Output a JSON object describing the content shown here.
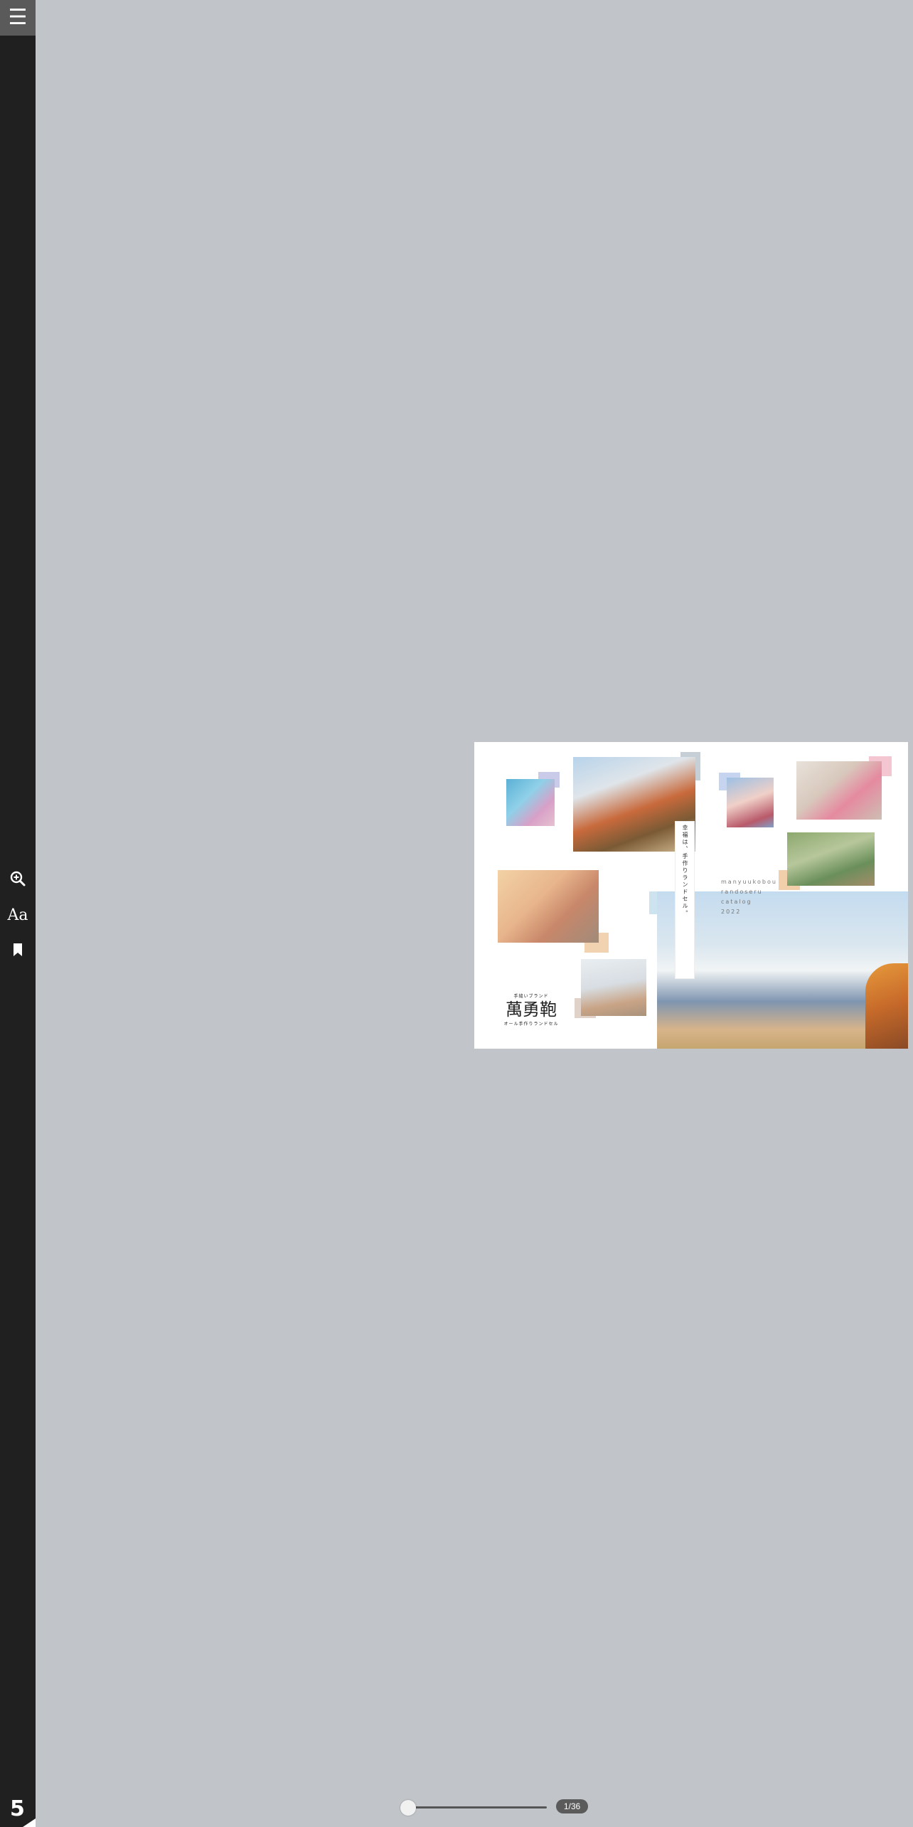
{
  "toolbar": {
    "menu_icon": "hamburger-menu-icon",
    "zoom_icon": "zoom-in-icon",
    "font_label": "Aa",
    "bookmark_icon": "bookmark-icon",
    "brand_label": "5"
  },
  "page": {
    "vertical_text": "幸福は、手作りランドセル。",
    "catalog_lines": [
      "manyuukobou",
      "randoseru",
      "catalog",
      "2022"
    ],
    "logo": {
      "sub": "手縫いブランド",
      "main": "萬勇鞄",
      "foot": "オール手作りランドセル"
    }
  },
  "slider": {
    "progress": 0.0,
    "page_label": "1/36"
  },
  "colors": {
    "background": "#c1c5c9",
    "sidebar": "#202020",
    "page": "#ffffff"
  }
}
